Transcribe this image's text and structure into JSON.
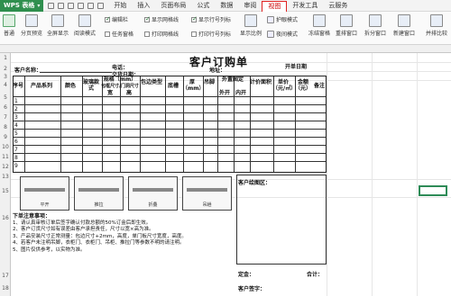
{
  "app": {
    "title": "WPS 表格"
  },
  "menu": [
    "开始",
    "插入",
    "页面布局",
    "公式",
    "数据",
    "审阅",
    "视图",
    "开发工具",
    "云服务"
  ],
  "active_menu": "视图",
  "ribbon": {
    "buttons": [
      "普通",
      "分页预览",
      "全屏显示",
      "阅读模式",
      "显示比例",
      "冻结窗格",
      "重排窗口",
      "拆分窗口",
      "新建窗口"
    ],
    "checks": [
      {
        "label": "编辑栏",
        "checked": true
      },
      {
        "label": "显示网格线",
        "checked": true
      },
      {
        "label": "显示行号列标",
        "checked": true
      },
      {
        "label": "任务窗格",
        "checked": false
      },
      {
        "label": "打印网格线",
        "checked": false
      },
      {
        "label": "打印行号列标",
        "checked": false
      }
    ],
    "tools": [
      "护眼模式",
      "夜间模式"
    ],
    "right_text": "并排比较"
  },
  "rows": [
    "1",
    "2",
    "3",
    "4",
    "5",
    "6",
    "7",
    "8",
    "9",
    "10",
    "11",
    "12",
    "13",
    "14",
    "15",
    "16",
    "17",
    "18",
    "19",
    "20",
    "21",
    "22",
    "23"
  ],
  "form": {
    "title": "客户订购单",
    "customer_name": "客户名称：",
    "phone": "电话：",
    "address": "地址：",
    "delivery": "交货日期：",
    "salesperson": "业务员：",
    "date": "开单日期",
    "headers": [
      "序号",
      "产品系列",
      "颜色",
      "玻璃款式",
      "规格（mm）",
      "宽",
      "高",
      "包边类型",
      "底槽",
      "厚（mm）",
      "吊脚",
      "外置固定",
      "外开",
      "内开",
      "计价面积",
      "单价（元/㎡）",
      "金额（元）",
      "备注"
    ],
    "spec_sub": "包框尺寸/门洞尺寸",
    "row_numbers": [
      "1",
      "2",
      "3",
      "4",
      "5",
      "6",
      "7",
      "8",
      "9",
      "10"
    ],
    "drawing_label": "客户绘图区：",
    "notes_title": "下单注意事项：",
    "notes": [
      "1、请认真审核订单后签字确认付款总额的50%订金后即生效。",
      "2、客户订货尺寸如有误差由客户承担责任，尺寸以宽×高为准。",
      "3、产品安装尺寸正常测量：包边尺寸+2mm，高度，单门板尺寸宽度，高度。",
      "4、若客户未注明吊脚，衣柜门、衣柜门、吊柜、推拉门等参数不明的请注明。",
      "5、图片仅供参考，以实物为准。"
    ],
    "signature": "客户签字：",
    "total": "合计：",
    "deposit": "定金："
  },
  "diagram_captions": [
    "平开",
    "推拉",
    "折叠",
    "吊趟"
  ]
}
